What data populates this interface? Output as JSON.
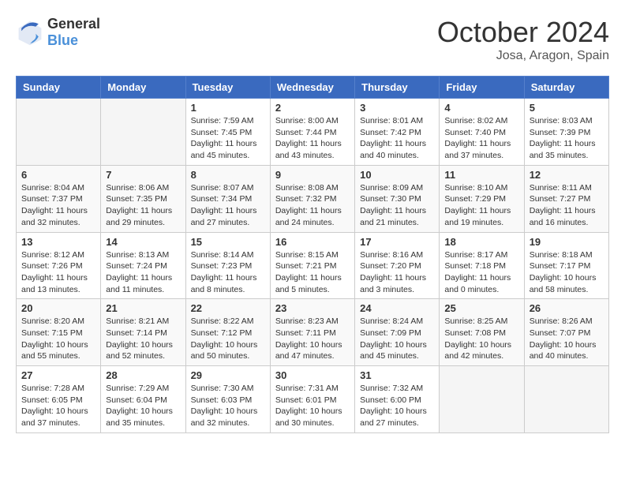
{
  "header": {
    "logo_general": "General",
    "logo_blue": "Blue",
    "month": "October 2024",
    "location": "Josa, Aragon, Spain"
  },
  "weekdays": [
    "Sunday",
    "Monday",
    "Tuesday",
    "Wednesday",
    "Thursday",
    "Friday",
    "Saturday"
  ],
  "weeks": [
    [
      {
        "day": "",
        "info": ""
      },
      {
        "day": "",
        "info": ""
      },
      {
        "day": "1",
        "info": "Sunrise: 7:59 AM\nSunset: 7:45 PM\nDaylight: 11 hours and 45 minutes."
      },
      {
        "day": "2",
        "info": "Sunrise: 8:00 AM\nSunset: 7:44 PM\nDaylight: 11 hours and 43 minutes."
      },
      {
        "day": "3",
        "info": "Sunrise: 8:01 AM\nSunset: 7:42 PM\nDaylight: 11 hours and 40 minutes."
      },
      {
        "day": "4",
        "info": "Sunrise: 8:02 AM\nSunset: 7:40 PM\nDaylight: 11 hours and 37 minutes."
      },
      {
        "day": "5",
        "info": "Sunrise: 8:03 AM\nSunset: 7:39 PM\nDaylight: 11 hours and 35 minutes."
      }
    ],
    [
      {
        "day": "6",
        "info": "Sunrise: 8:04 AM\nSunset: 7:37 PM\nDaylight: 11 hours and 32 minutes."
      },
      {
        "day": "7",
        "info": "Sunrise: 8:06 AM\nSunset: 7:35 PM\nDaylight: 11 hours and 29 minutes."
      },
      {
        "day": "8",
        "info": "Sunrise: 8:07 AM\nSunset: 7:34 PM\nDaylight: 11 hours and 27 minutes."
      },
      {
        "day": "9",
        "info": "Sunrise: 8:08 AM\nSunset: 7:32 PM\nDaylight: 11 hours and 24 minutes."
      },
      {
        "day": "10",
        "info": "Sunrise: 8:09 AM\nSunset: 7:30 PM\nDaylight: 11 hours and 21 minutes."
      },
      {
        "day": "11",
        "info": "Sunrise: 8:10 AM\nSunset: 7:29 PM\nDaylight: 11 hours and 19 minutes."
      },
      {
        "day": "12",
        "info": "Sunrise: 8:11 AM\nSunset: 7:27 PM\nDaylight: 11 hours and 16 minutes."
      }
    ],
    [
      {
        "day": "13",
        "info": "Sunrise: 8:12 AM\nSunset: 7:26 PM\nDaylight: 11 hours and 13 minutes."
      },
      {
        "day": "14",
        "info": "Sunrise: 8:13 AM\nSunset: 7:24 PM\nDaylight: 11 hours and 11 minutes."
      },
      {
        "day": "15",
        "info": "Sunrise: 8:14 AM\nSunset: 7:23 PM\nDaylight: 11 hours and 8 minutes."
      },
      {
        "day": "16",
        "info": "Sunrise: 8:15 AM\nSunset: 7:21 PM\nDaylight: 11 hours and 5 minutes."
      },
      {
        "day": "17",
        "info": "Sunrise: 8:16 AM\nSunset: 7:20 PM\nDaylight: 11 hours and 3 minutes."
      },
      {
        "day": "18",
        "info": "Sunrise: 8:17 AM\nSunset: 7:18 PM\nDaylight: 11 hours and 0 minutes."
      },
      {
        "day": "19",
        "info": "Sunrise: 8:18 AM\nSunset: 7:17 PM\nDaylight: 10 hours and 58 minutes."
      }
    ],
    [
      {
        "day": "20",
        "info": "Sunrise: 8:20 AM\nSunset: 7:15 PM\nDaylight: 10 hours and 55 minutes."
      },
      {
        "day": "21",
        "info": "Sunrise: 8:21 AM\nSunset: 7:14 PM\nDaylight: 10 hours and 52 minutes."
      },
      {
        "day": "22",
        "info": "Sunrise: 8:22 AM\nSunset: 7:12 PM\nDaylight: 10 hours and 50 minutes."
      },
      {
        "day": "23",
        "info": "Sunrise: 8:23 AM\nSunset: 7:11 PM\nDaylight: 10 hours and 47 minutes."
      },
      {
        "day": "24",
        "info": "Sunrise: 8:24 AM\nSunset: 7:09 PM\nDaylight: 10 hours and 45 minutes."
      },
      {
        "day": "25",
        "info": "Sunrise: 8:25 AM\nSunset: 7:08 PM\nDaylight: 10 hours and 42 minutes."
      },
      {
        "day": "26",
        "info": "Sunrise: 8:26 AM\nSunset: 7:07 PM\nDaylight: 10 hours and 40 minutes."
      }
    ],
    [
      {
        "day": "27",
        "info": "Sunrise: 7:28 AM\nSunset: 6:05 PM\nDaylight: 10 hours and 37 minutes."
      },
      {
        "day": "28",
        "info": "Sunrise: 7:29 AM\nSunset: 6:04 PM\nDaylight: 10 hours and 35 minutes."
      },
      {
        "day": "29",
        "info": "Sunrise: 7:30 AM\nSunset: 6:03 PM\nDaylight: 10 hours and 32 minutes."
      },
      {
        "day": "30",
        "info": "Sunrise: 7:31 AM\nSunset: 6:01 PM\nDaylight: 10 hours and 30 minutes."
      },
      {
        "day": "31",
        "info": "Sunrise: 7:32 AM\nSunset: 6:00 PM\nDaylight: 10 hours and 27 minutes."
      },
      {
        "day": "",
        "info": ""
      },
      {
        "day": "",
        "info": ""
      }
    ]
  ]
}
